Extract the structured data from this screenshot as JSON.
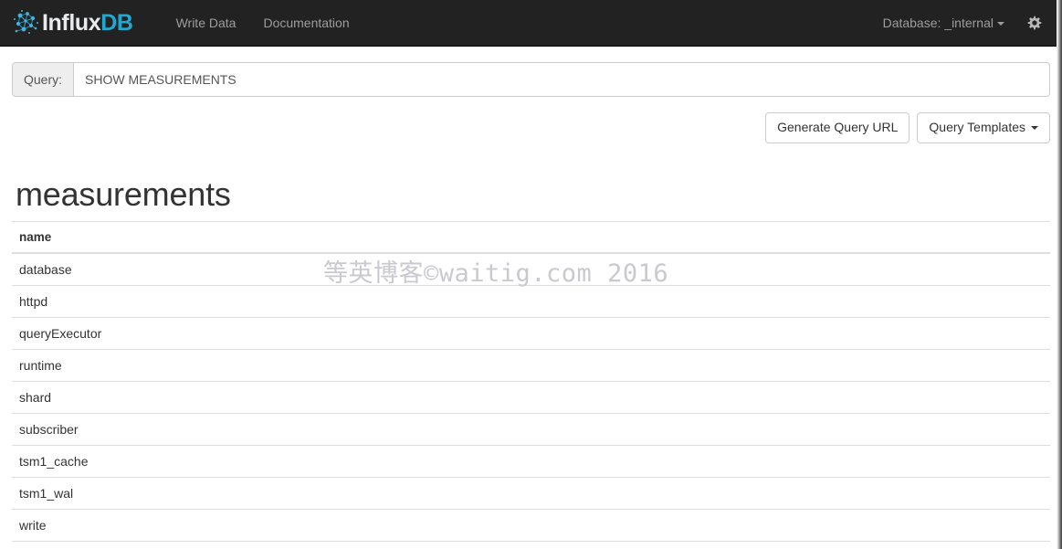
{
  "navbar": {
    "brand": {
      "influx": "Influx",
      "db": "DB",
      "icon": "influxdb-molecule-icon"
    },
    "links": [
      {
        "label": "Write Data"
      },
      {
        "label": "Documentation"
      }
    ],
    "database_selector": {
      "label": "Database: _internal"
    },
    "settings_icon": "gear-icon",
    "colors": {
      "background": "#222222",
      "link": "#9d9d9d",
      "brand_accent": "#20a8d0"
    }
  },
  "query": {
    "addon_label": "Query:",
    "value": "SHOW MEASUREMENTS",
    "placeholder": "Enter query",
    "generate_url_label": "Generate Query URL",
    "templates_label": "Query Templates"
  },
  "results": {
    "heading": "measurements",
    "columns": [
      "name"
    ],
    "rows": [
      [
        "database"
      ],
      [
        "httpd"
      ],
      [
        "queryExecutor"
      ],
      [
        "runtime"
      ],
      [
        "shard"
      ],
      [
        "subscriber"
      ],
      [
        "tsm1_cache"
      ],
      [
        "tsm1_wal"
      ],
      [
        "write"
      ]
    ]
  },
  "watermark": {
    "text": "等英博客©waitig.com  2016",
    "color": "#c9c9cf"
  }
}
